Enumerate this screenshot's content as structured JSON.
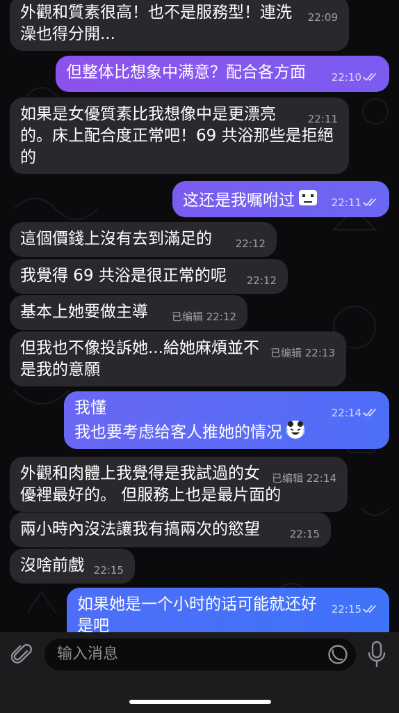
{
  "messages": [
    {
      "dir": "in",
      "text": "外觀和質素很高！也不是服務型！連洗澡也得分開...",
      "edited": "",
      "time": "22:09"
    },
    {
      "dir": "out",
      "text": "但整体比想象中满意？配合各方面",
      "edited": "",
      "time": "22:10"
    },
    {
      "dir": "in",
      "text": "如果是女優質素比我想像中是更漂亮的。床上配合度正常吧！69 共浴那些是拒絕的",
      "edited": "",
      "time": "22:11"
    },
    {
      "dir": "out",
      "text": "这还是我嘱咐过",
      "edited": "",
      "time": "22:11",
      "emoji": "sweat-emoji"
    },
    {
      "dir": "in",
      "text": "這個價錢上沒有去到滿足的",
      "edited": "",
      "time": "22:12"
    },
    {
      "dir": "in",
      "text": "我覺得 69 共浴是很正常的呢",
      "edited": "",
      "time": "22:12"
    },
    {
      "dir": "in",
      "text": "基本上她要做主導",
      "edited": "已编辑",
      "time": "22:12"
    },
    {
      "dir": "in",
      "text": "但我也不像投訴她...給她麻煩並不是我的意願",
      "edited": "已编辑",
      "time": "22:13"
    },
    {
      "dir": "out",
      "text": "我懂\n我也要考虑给客人推她的情况",
      "edited": "",
      "time": "22:14",
      "emoji": "laughing-crying-emoji"
    },
    {
      "dir": "in",
      "text": "外觀和肉體上我覺得是我試過的女優裡最好的。 但服務上也是最片面的",
      "edited": "已编辑",
      "time": "22:14"
    },
    {
      "dir": "in",
      "text": "兩小時內沒法讓我有搞兩次的慾望",
      "edited": "",
      "time": "22:15"
    },
    {
      "dir": "in",
      "text": "沒啥前戲",
      "edited": "",
      "time": "22:15"
    },
    {
      "dir": "out",
      "text": "如果她是一个小时的话可能就还好是吧",
      "edited": "",
      "time": "22:15"
    }
  ],
  "composer": {
    "placeholder": "输入消息"
  },
  "icons": {
    "attach": "paperclip-icon",
    "sticker": "sticker-icon",
    "mic": "microphone-icon",
    "read": "double-check-icon"
  },
  "colors": {
    "incoming": "#2a282d",
    "out_1": "#8d52ec",
    "out_2": "#7b5cf0",
    "out_3": "#6a67f3",
    "out_4": "#4e6ef8",
    "out_5": "#3f73f9"
  }
}
